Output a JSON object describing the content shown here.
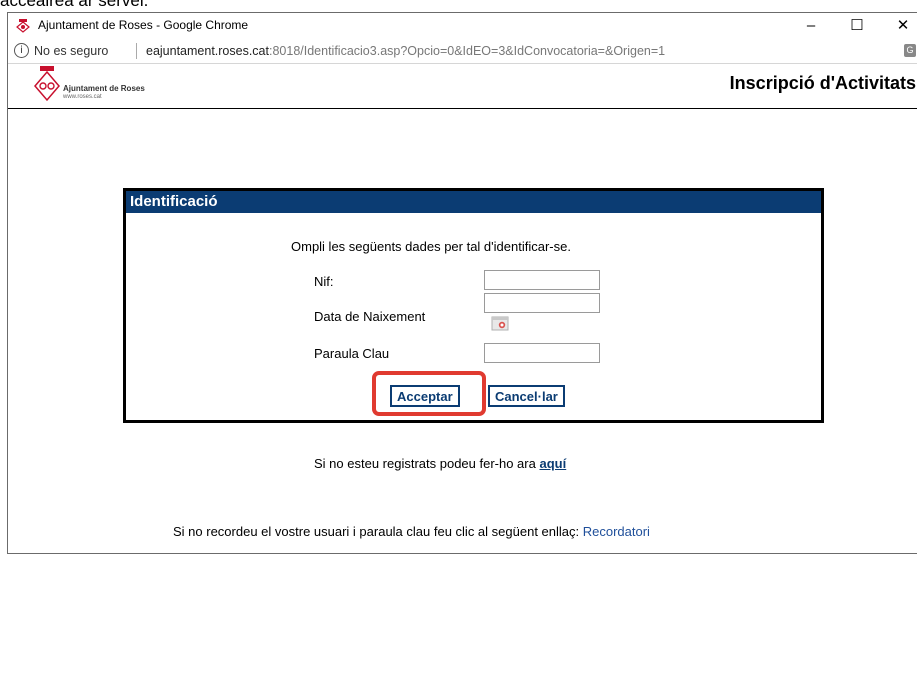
{
  "overlay": {
    "cropped_text": "acceairea ar servei."
  },
  "window": {
    "title": "Ajuntament de Roses - Google Chrome",
    "minimize_glyph": "–",
    "maximize_glyph": "☐",
    "close_glyph": "✕",
    "app_icon": "roses-crest-icon"
  },
  "address_bar": {
    "info_glyph": "i",
    "security_label": "No es seguro",
    "url_host": "eajuntament.roses.cat",
    "url_rest": ":8018/Identificacio3.asp?Opcio=0&IdEO=3&IdConvocatoria=&Origen=1",
    "translate_glyph": "G"
  },
  "header": {
    "logo_name": "Ajuntament de Roses",
    "logo_url": "www.roses.cat",
    "page_title": "Inscripció d'Activitats"
  },
  "form": {
    "title": "Identificació",
    "intro": "Ompli les següents dades per tal d'identificar-se.",
    "fields": [
      {
        "label": "Nif:",
        "value": ""
      },
      {
        "label": "Data de Naixement",
        "value": ""
      },
      {
        "label": "Paraula Clau",
        "value": ""
      }
    ],
    "accept_label": "Acceptar",
    "cancel_label": "Cancel·lar",
    "highlight_color": "#e03a30"
  },
  "links": {
    "register_text": "Si no esteu registrats podeu fer-ho ara",
    "register_link": "aquí",
    "reminder_text": "Si no recordeu el vostre usuari i paraula clau feu clic al següent enllaç:",
    "reminder_link": "Recordatori"
  },
  "colors": {
    "panel_header": "#0b3c73",
    "link": "#1f4f9a"
  }
}
